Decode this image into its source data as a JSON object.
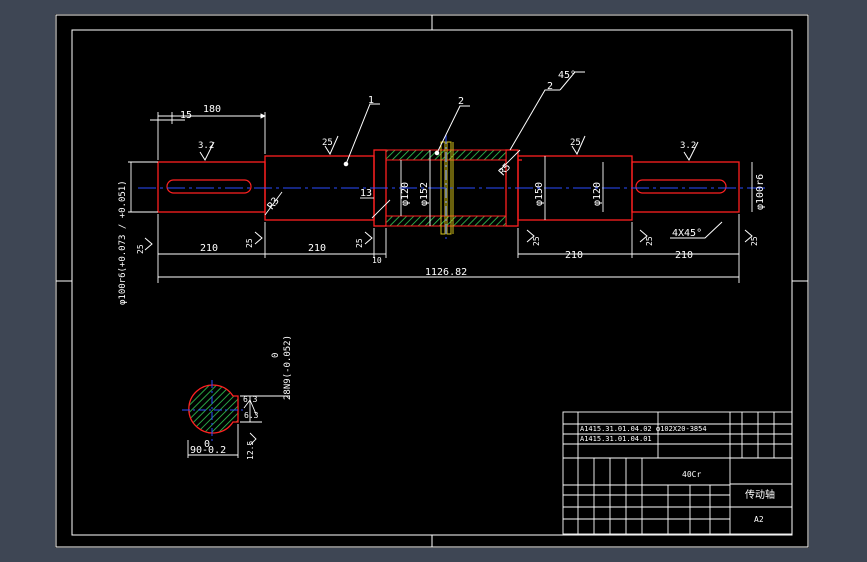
{
  "colors": {
    "background": "#3e4654",
    "paper": "#000000",
    "line": "#ffffff",
    "part_outline": "#ff2020",
    "centerline": "#2a4cff",
    "hatch": "#33cc55",
    "gear_band": "#d4c21a"
  },
  "balloons": {
    "b1": "1",
    "b2": "2",
    "b3": "2"
  },
  "dims": {
    "d180": "180",
    "d15": "15",
    "d210a": "210",
    "d210b": "210",
    "d210c": "210",
    "d210d": "210",
    "total": "1126.82",
    "d13": "13",
    "d10": "10",
    "phi120a": "φ120",
    "phi152": "φ152",
    "phi150": "φ150",
    "phi120b": "φ120",
    "phi100r6_right": "φ100r6",
    "phi100r6_left": "φ100r6(+0.073 / +0.051)",
    "r3": "R3",
    "r5": "R5",
    "chamfer45": "45°",
    "chamfer4x45": "4X45°",
    "sec_90": "90-0.2",
    "sec_0": "0",
    "sec_28n9": "28N9(-0.052)",
    "sec_63a": "6.3",
    "sec_63b": "6.3",
    "sec_125": "12.5"
  },
  "roughness": {
    "r32a": "3.2",
    "r25a": "25",
    "r25b": "25",
    "r32b": "3.2",
    "r25c": "25",
    "r25d": "25",
    "r25e": "25",
    "r25f": "25",
    "r25g": "25",
    "r25h": "25"
  },
  "title_block": {
    "ref1": "A1415.31.01.04.02",
    "ref2": "A1415.31.01.04.01",
    "ref3": "φ102X20-3854",
    "material": "40Cr",
    "part_name": "传动轴",
    "sheet": "A2"
  }
}
